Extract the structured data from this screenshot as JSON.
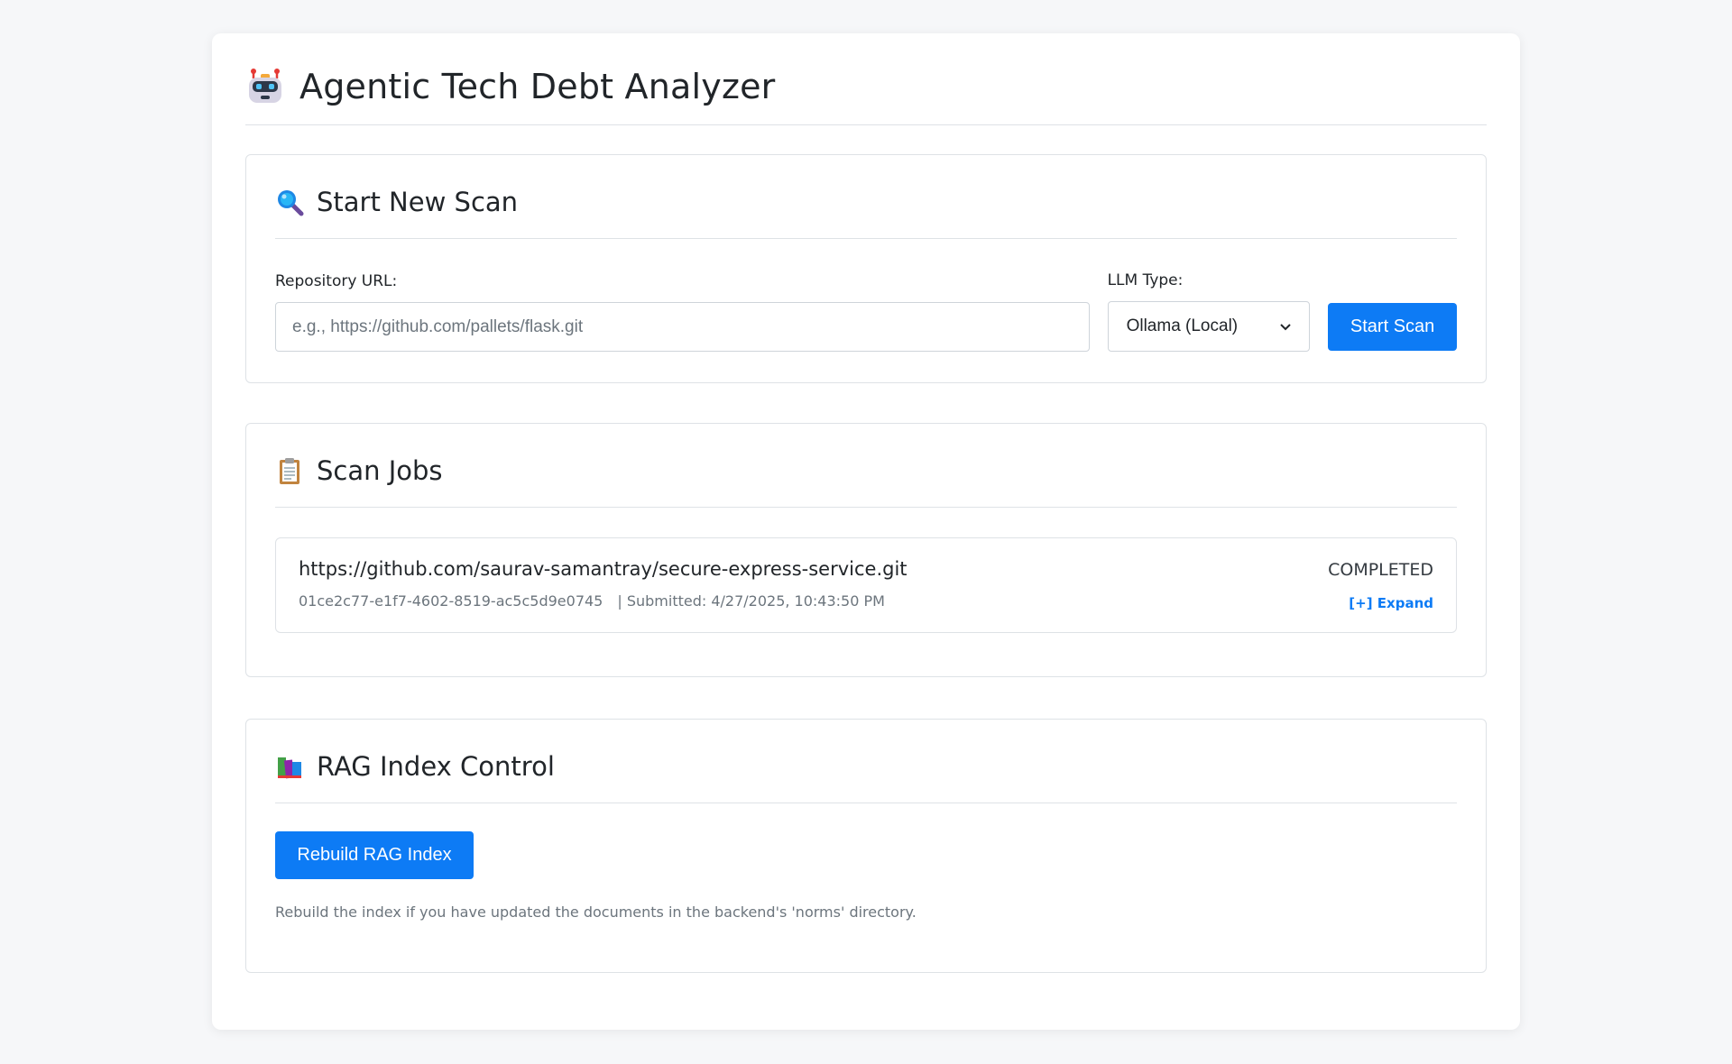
{
  "header": {
    "title": "Agentic Tech Debt Analyzer",
    "icon": "robot-icon"
  },
  "scan": {
    "title": "Start New Scan",
    "icon": "magnifier-icon",
    "repo_label": "Repository URL:",
    "repo_placeholder": "e.g., https://github.com/pallets/flask.git",
    "repo_value": "",
    "llm_label": "LLM Type:",
    "llm_selected": "Ollama (Local)",
    "start_label": "Start Scan"
  },
  "jobs": {
    "title": "Scan Jobs",
    "icon": "clipboard-icon",
    "items": [
      {
        "url": "https://github.com/saurav-samantray/secure-express-service.git",
        "id": "01ce2c77-e1f7-4602-8519-ac5c5d9e0745",
        "submitted": "| Submitted: 4/27/2025, 10:43:50 PM",
        "status": "COMPLETED",
        "expand": "[+] Expand"
      }
    ]
  },
  "rag": {
    "title": "RAG Index Control",
    "icon": "books-icon",
    "button_label": "Rebuild RAG Index",
    "note": "Rebuild the index if you have updated the documents in the backend's 'norms' directory."
  },
  "colors": {
    "accent": "#0d7bf5",
    "background": "#f6f7f9",
    "card_border": "#dee2e6",
    "muted_text": "#6c757d"
  }
}
